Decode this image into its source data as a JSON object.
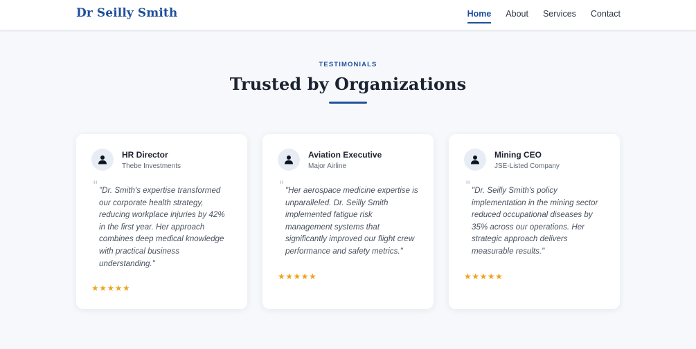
{
  "nav": {
    "brand": "Dr Seilly Smith",
    "links": [
      {
        "label": "Home",
        "active": true
      },
      {
        "label": "About"
      },
      {
        "label": "Services"
      },
      {
        "label": "Contact"
      }
    ]
  },
  "section": {
    "eyebrow": "TESTIMONIALS",
    "title": "Trusted by Organizations",
    "accent_color": "#1f4f9c"
  },
  "testimonials": [
    {
      "title": "HR Director",
      "organization": "Thebe Investments",
      "quote": "\"Dr. Smith's expertise transformed our corporate health strategy, reducing workplace injuries by 42% in the first year. Her approach combines deep medical knowledge with practical business understanding.\"",
      "stars": "★★★★★",
      "rating": 5
    },
    {
      "title": "Aviation Executive",
      "organization": "Major Airline",
      "quote": "\"Her aerospace medicine expertise is unparalleled. Dr. Seilly Smith implemented fatigue risk management systems that significantly improved our flight crew performance and safety metrics.\"",
      "stars": "★★★★★",
      "rating": 5
    },
    {
      "title": "Mining CEO",
      "organization": "JSE-Listed Company",
      "quote": "\"Dr. Seilly Smith's policy implementation in the mining sector reduced occupational diseases by 35% across our operations. Her strategic approach delivers measurable results.\"",
      "stars": "★★★★★",
      "rating": 5
    }
  ],
  "icons": {
    "avatar": "user-icon",
    "quote": "quote-icon",
    "star": "star-icon"
  },
  "colors": {
    "brand": "#1f4f9c",
    "star": "#f0a21c",
    "background": "#f6f8fb"
  }
}
